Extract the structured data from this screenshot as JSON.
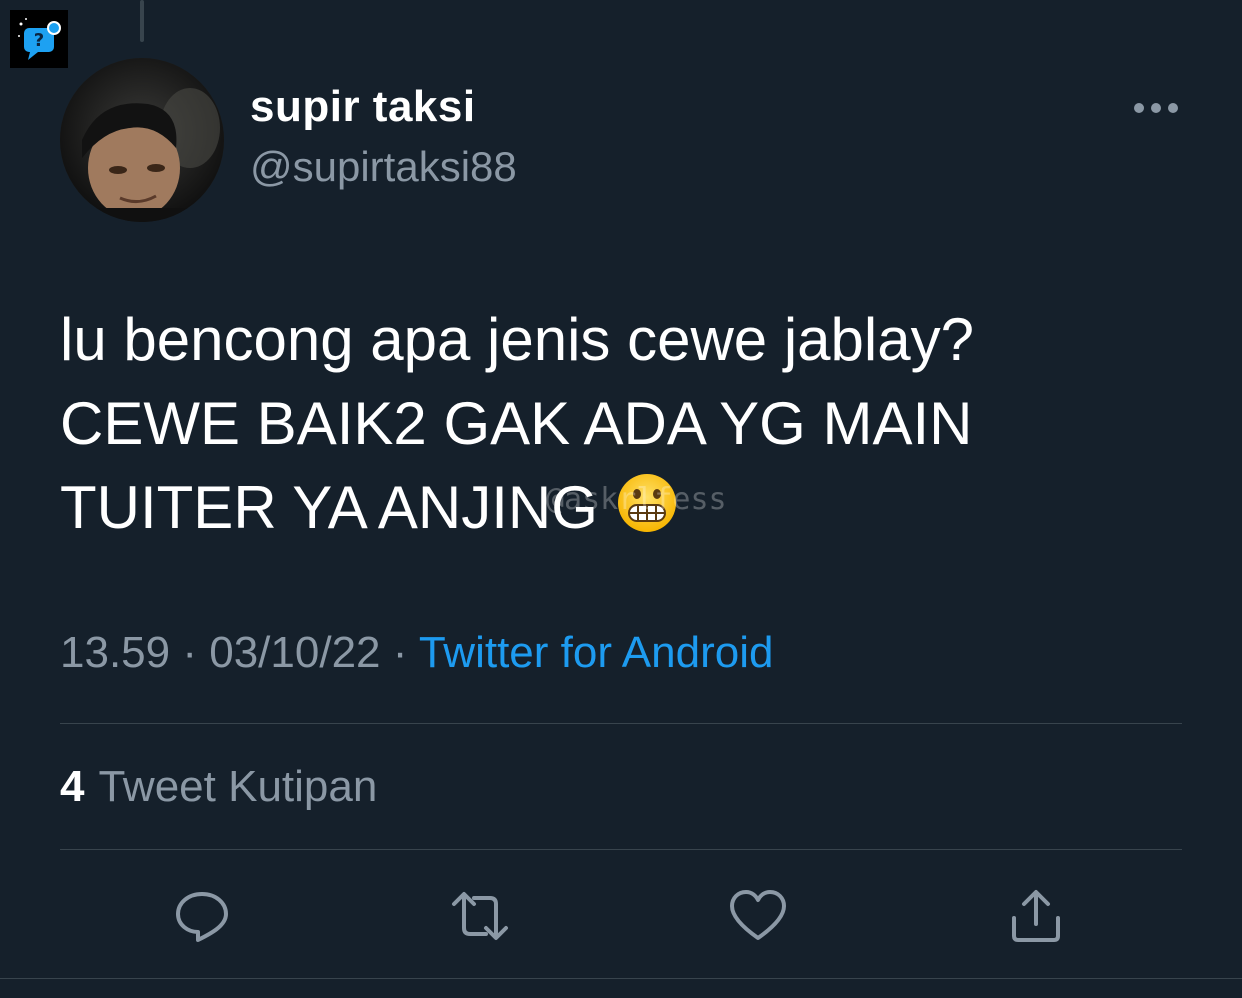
{
  "tweet": {
    "display_name": "supir taksi",
    "handle": "@supirtaksi88",
    "text": "lu bencong apa jenis cewe jablay?\nCEWE BAIK2 GAK ADA YG MAIN\nTUITER YA ANJING",
    "emoji": "grimacing-face",
    "watermark": "@askrlfess",
    "time": "13.59",
    "separator": "·",
    "date": "03/10/22",
    "source": "Twitter for Android"
  },
  "stats": {
    "quote_count": "4",
    "quote_label": "Tweet Kutipan"
  },
  "actions": [
    {
      "name": "reply",
      "icon": "reply-icon"
    },
    {
      "name": "retweet",
      "icon": "retweet-icon"
    },
    {
      "name": "like",
      "icon": "heart-icon"
    },
    {
      "name": "share",
      "icon": "share-icon"
    }
  ],
  "colors": {
    "background": "#15202b",
    "text_primary": "#ffffff",
    "text_secondary": "#8b98a5",
    "accent": "#1d9bf0",
    "divider": "#38444d"
  }
}
